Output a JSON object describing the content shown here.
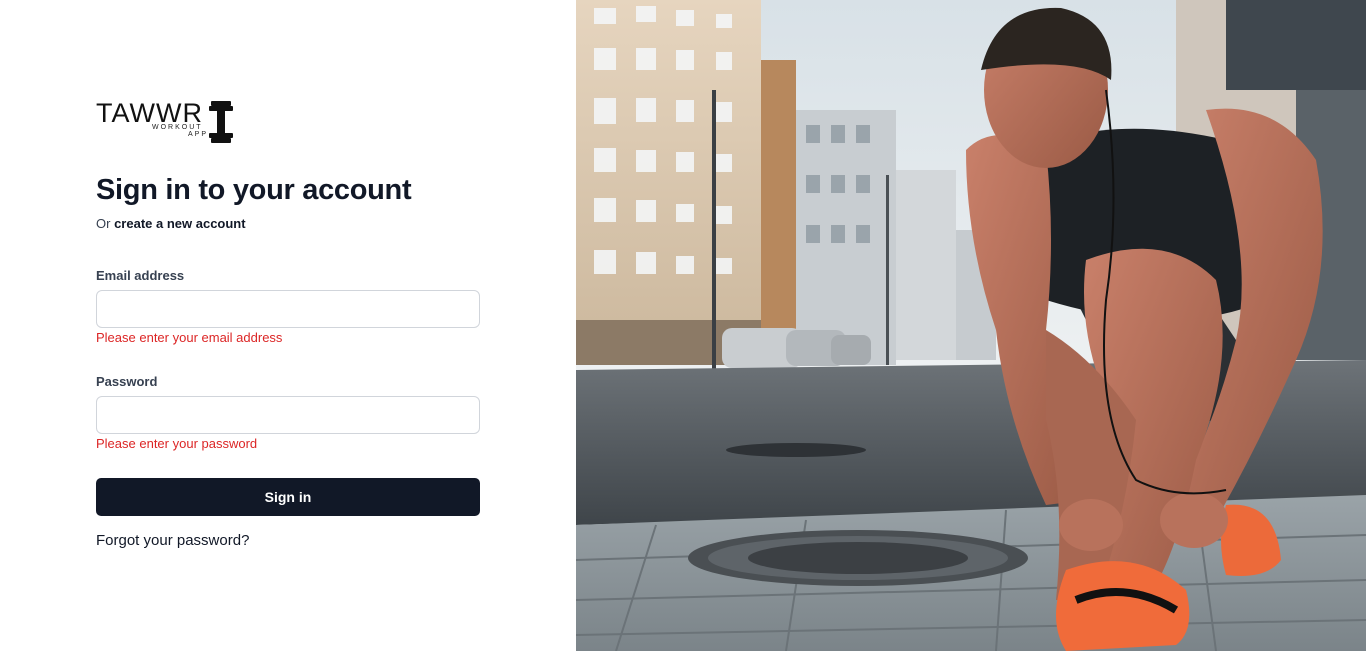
{
  "logo": {
    "name": "TAWWR",
    "tagline_line1": "WORKOUT",
    "tagline_line2": "APP"
  },
  "heading": "Sign in to your account",
  "subtitle": {
    "prefix": "Or",
    "link": "create a new account"
  },
  "form": {
    "email": {
      "label": "Email address",
      "value": "",
      "error": "Please enter your email address"
    },
    "password": {
      "label": "Password",
      "value": "",
      "error": "Please enter your password"
    },
    "submit_label": "Sign in",
    "forgot_label": "Forgot your password?"
  },
  "colors": {
    "primary": "#111827",
    "error": "#dc2626"
  }
}
